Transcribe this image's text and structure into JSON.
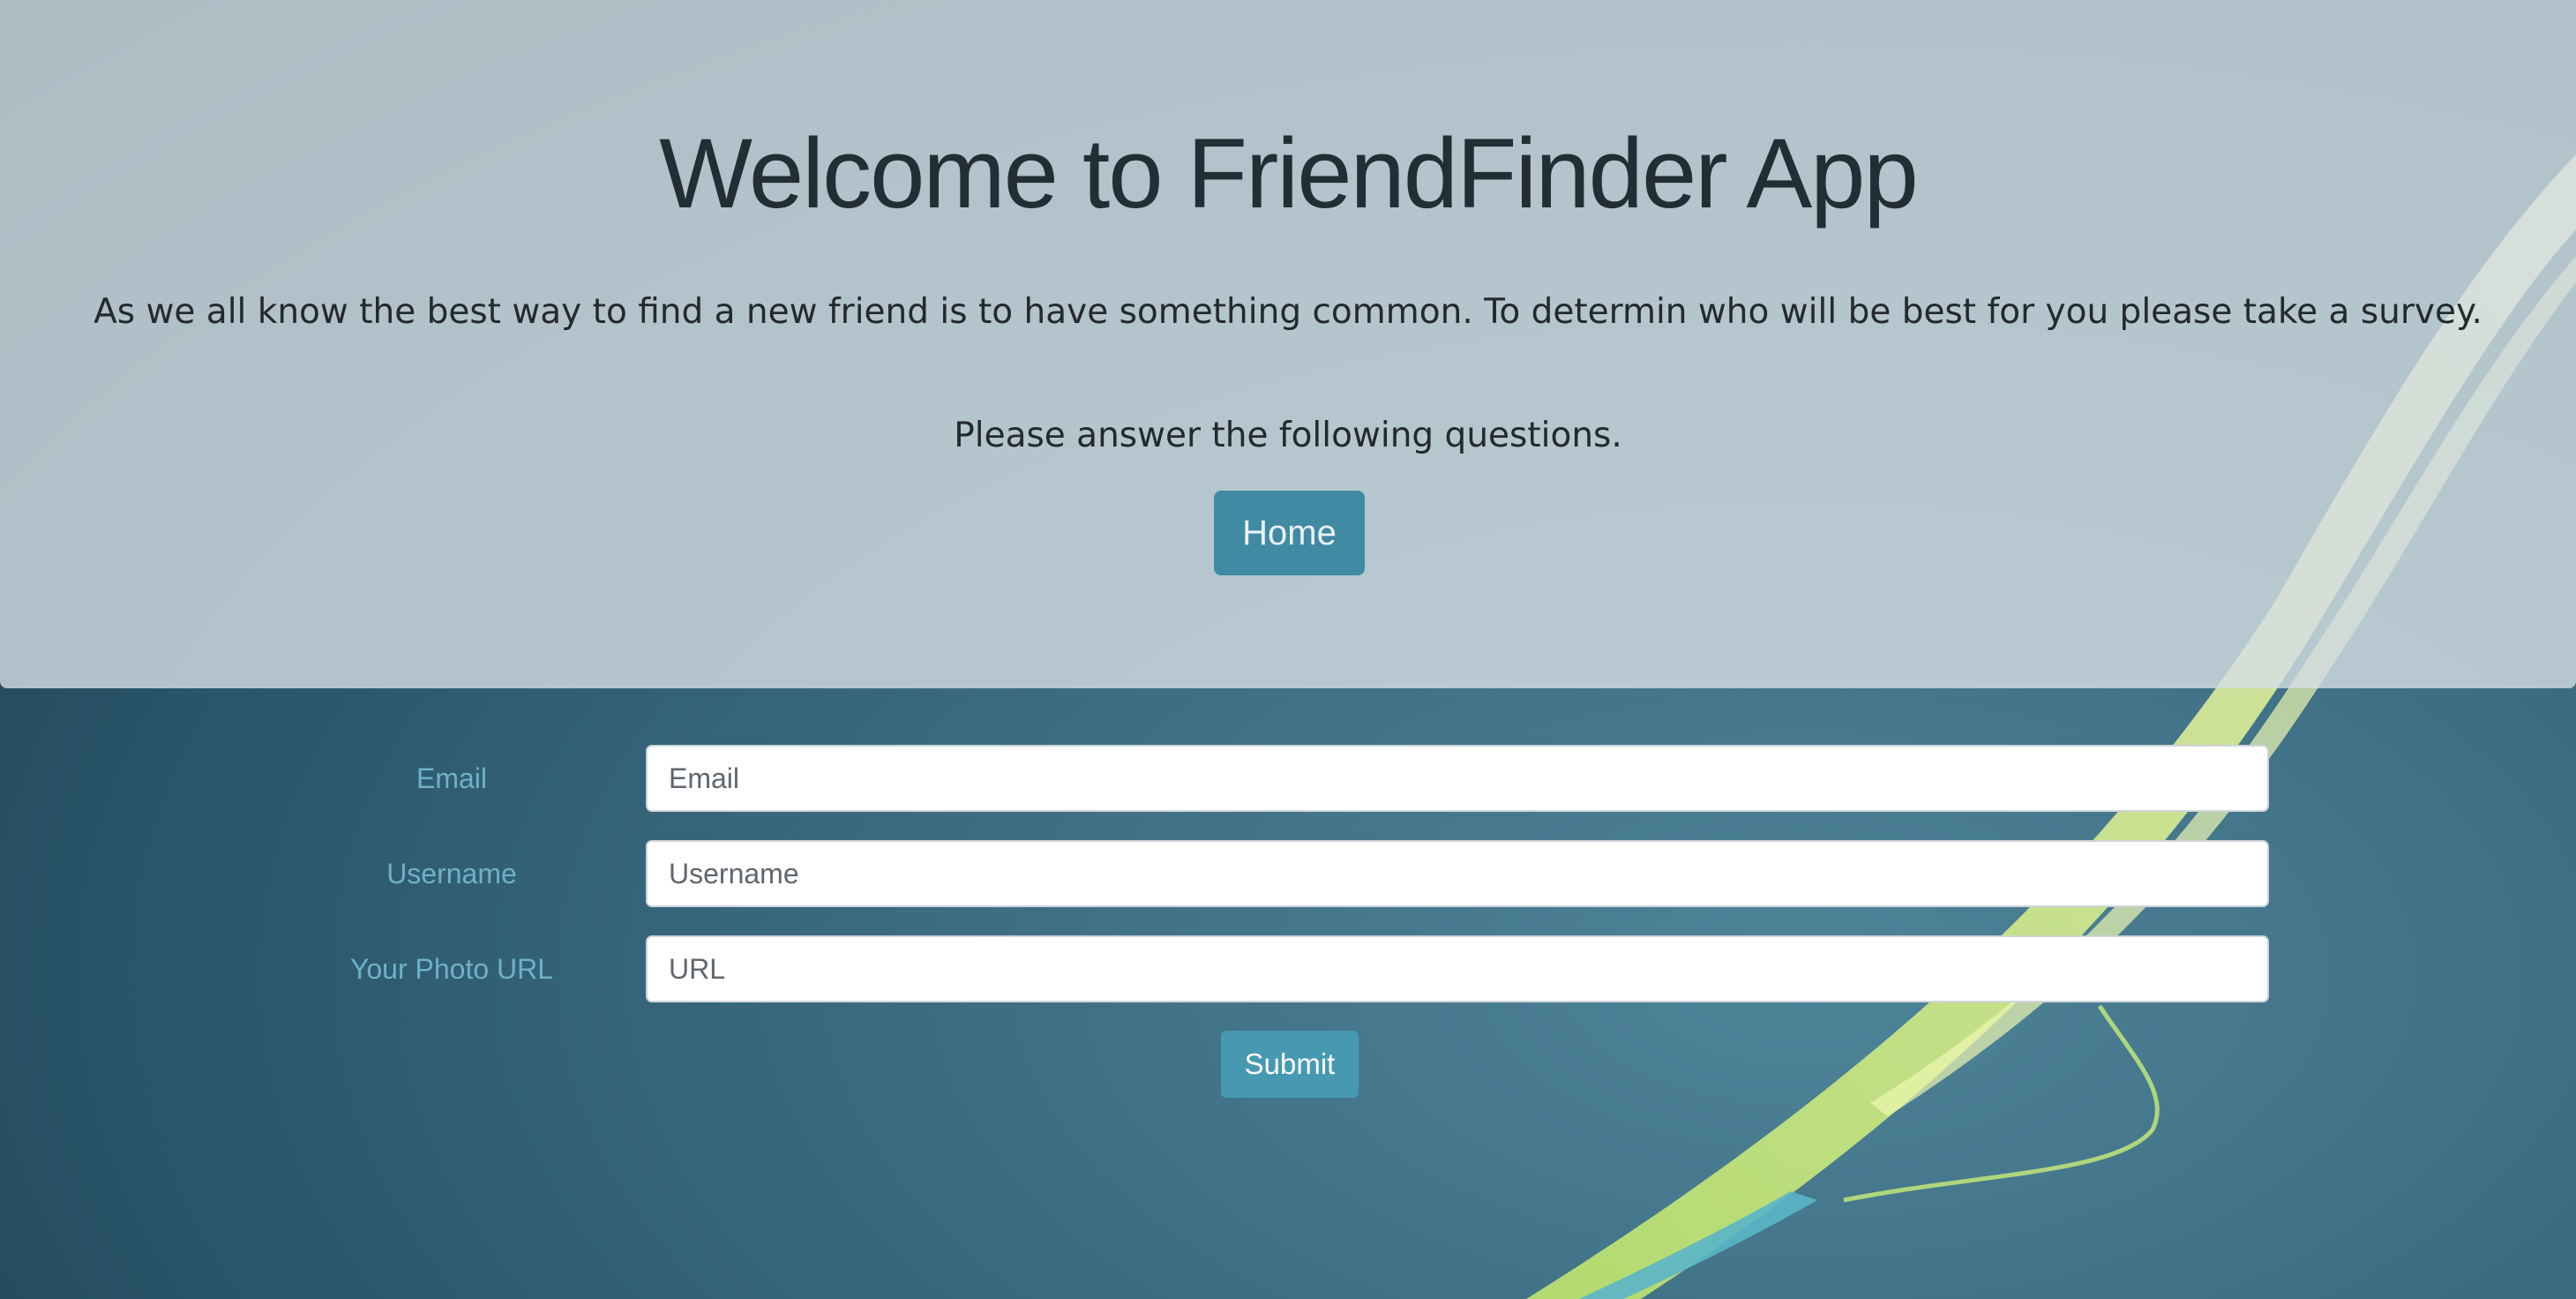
{
  "header": {
    "title": "Welcome to FriendFinder App",
    "intro": "As we all know the best way to find a new friend is to have something common. To determin who will be best for you please take a survey.",
    "instruction": "Please answer the following questions.",
    "home_button_label": "Home"
  },
  "form": {
    "fields": [
      {
        "label": "Email",
        "placeholder": "Email",
        "value": ""
      },
      {
        "label": "Username",
        "placeholder": "Username",
        "value": ""
      },
      {
        "label": "Your Photo URL",
        "placeholder": "URL",
        "value": ""
      }
    ],
    "submit_label": "Submit"
  },
  "colors": {
    "button": "#418aa3",
    "label": "#6fb1c9",
    "ribbon": "#d8f07a"
  },
  "icons": {
    "background": "abstract-ribbon-background"
  }
}
